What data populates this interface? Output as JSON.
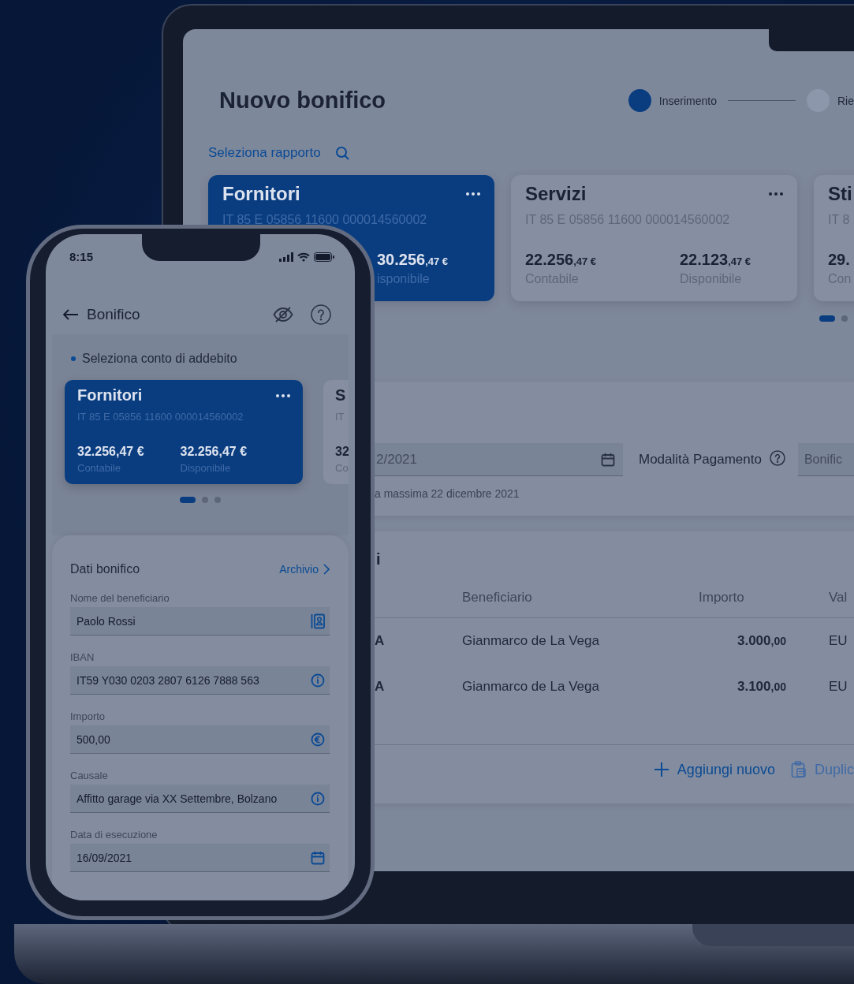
{
  "laptop": {
    "title": "Nuovo bonifico",
    "steps": [
      {
        "label": "Inserimento",
        "selected": true
      },
      {
        "label": "Rie",
        "selected": false
      }
    ],
    "account_picker": {
      "label": "Seleziona rapporto"
    },
    "accounts": [
      {
        "name": "Fornitori",
        "iban": "IT 85 E 05856 11600 000014560002",
        "selected": true,
        "balances": [
          {
            "kind": "available",
            "amount": "30.256",
            "cents": ",47 €",
            "label": "isponibile"
          }
        ]
      },
      {
        "name": "Servizi",
        "iban": "IT 85 E 05856 11600 000014560002",
        "selected": false,
        "balances": [
          {
            "kind": "booked",
            "amount": "22.256",
            "cents": ",47 €",
            "label": "Contabile"
          },
          {
            "kind": "available",
            "amount": "22.123",
            "cents": ",47 €",
            "label": "Disponibile"
          }
        ]
      },
      {
        "name": "Sti",
        "iban": "IT 8",
        "selected": false,
        "balances": [
          {
            "kind": "booked",
            "amount": "29.",
            "label": "Con"
          }
        ]
      }
    ],
    "carousel_dots": [
      {
        "selected": true
      },
      {
        "selected": false
      }
    ],
    "execution": {
      "date_value": "2/2021",
      "hint": "a massima 22 dicembre 2021",
      "payment_mode_label": "Modalità Pagamento",
      "payment_mode_value": "Bonific"
    },
    "transfers": {
      "title": "i",
      "columns": [
        "Beneficiario",
        "Importo",
        "Val"
      ],
      "rows": [
        {
          "column_1": "A",
          "beneficiary": "Gianmarco de La Vega",
          "amount": "3.000",
          "cents": ",00",
          "column_4": "EU"
        },
        {
          "column_1": "A",
          "beneficiary": "Gianmarco de La Vega",
          "amount": "3.100",
          "cents": ",00",
          "column_4": "EU"
        }
      ],
      "actions": [
        {
          "kind": "add",
          "label": "Aggiungi nuovo"
        },
        {
          "kind": "duplicate",
          "label": "Duplic"
        }
      ]
    }
  },
  "phone": {
    "time": "8:15",
    "title": "Bonifico",
    "section_label": "Seleziona conto di addebito",
    "accounts": [
      {
        "name": "Fornitori",
        "iban": "IT 85 E 05856 11600 000014560002",
        "selected": true,
        "balances": [
          {
            "amount": "32.256,47 €",
            "label": "Contabile"
          },
          {
            "amount": "32.256,47 €",
            "label": "Disponibile"
          }
        ]
      },
      {
        "name": "S",
        "iban": "IT",
        "selected": false,
        "balances": [
          {
            "amount": "32",
            "label": "Co"
          }
        ]
      }
    ],
    "carousel_dots": [
      {
        "selected": true
      },
      {
        "selected": false
      },
      {
        "selected": false
      }
    ],
    "form": {
      "title": "Dati bonifico",
      "archive_link": "Archivio",
      "fields": [
        {
          "kind": "contact",
          "label": "Nome del beneficiario",
          "value": "Paolo Rossi"
        },
        {
          "kind": "info",
          "label": "IBAN",
          "value": "IT59 Y030 0203 2807 6126 7888 563"
        },
        {
          "kind": "currency",
          "label": "Importo",
          "value": "500,00"
        },
        {
          "kind": "info",
          "label": "Causale",
          "value": "Affitto garage via XX Settembre, Bolzano"
        },
        {
          "kind": "date",
          "label": "Data di esecuzione",
          "value": "16/09/2021"
        }
      ]
    }
  }
}
